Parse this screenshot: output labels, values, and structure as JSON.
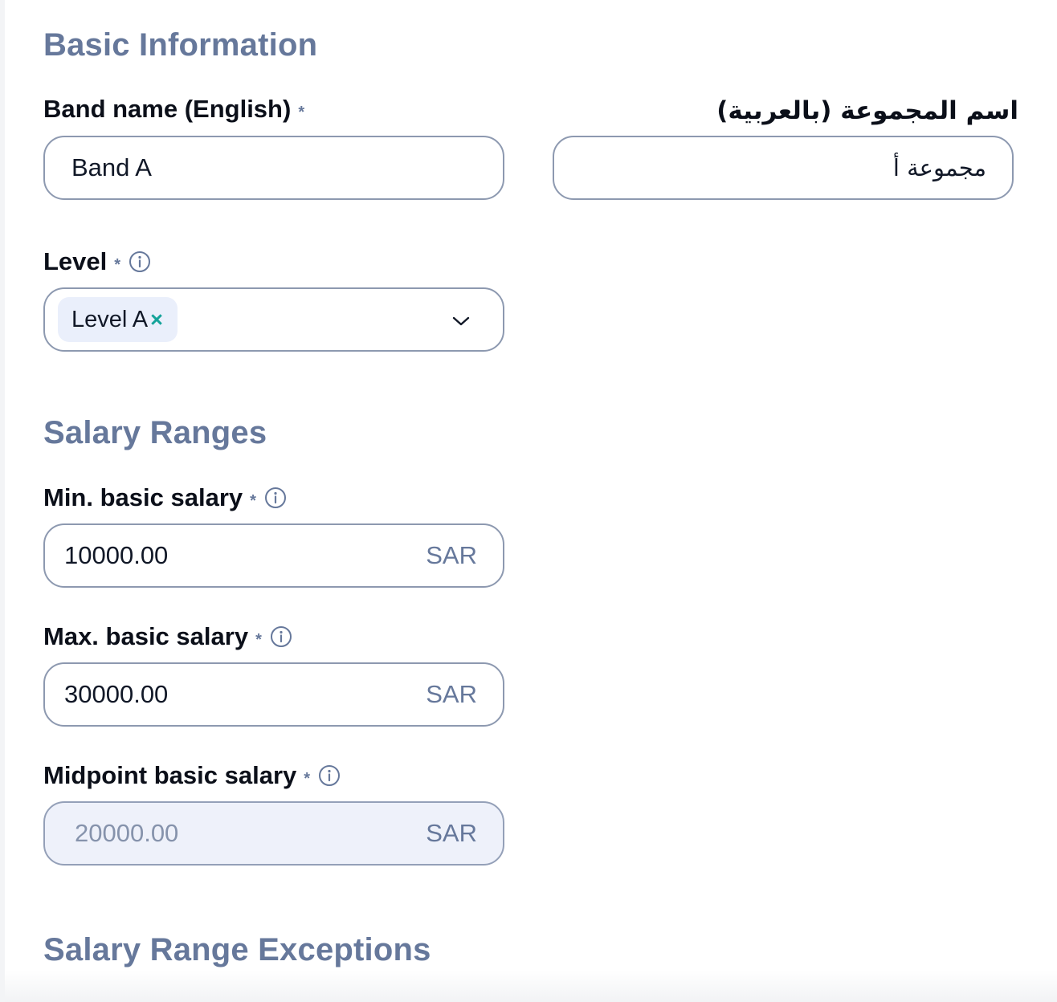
{
  "sections": {
    "basic_information": "Basic Information",
    "salary_ranges": "Salary Ranges",
    "salary_range_exceptions": "Salary Range Exceptions"
  },
  "band_name_en": {
    "label": "Band name (English)",
    "required_mark": "*",
    "value": "Band A"
  },
  "band_name_ar": {
    "label": "اسم المجموعة (بالعربية)",
    "value": "مجموعة أ"
  },
  "level": {
    "label": "Level",
    "required_mark": "*",
    "selected_chip": "Level A",
    "chip_remove": "×",
    "icon": "chevron-down-icon"
  },
  "min_salary": {
    "label": "Min. basic salary",
    "required_mark": "*",
    "value": "10000.00",
    "unit": "SAR"
  },
  "max_salary": {
    "label": "Max. basic salary",
    "required_mark": "*",
    "value": "30000.00",
    "unit": "SAR"
  },
  "midpoint_salary": {
    "label": "Midpoint basic salary",
    "required_mark": "*",
    "value": "20000.00",
    "unit": "SAR"
  },
  "colors": {
    "section_title": "#66789b",
    "input_border": "#8d99b0",
    "chip_bg": "#eaeffb",
    "chip_remove": "#14a39a",
    "disabled_bg": "#eef1fa"
  }
}
